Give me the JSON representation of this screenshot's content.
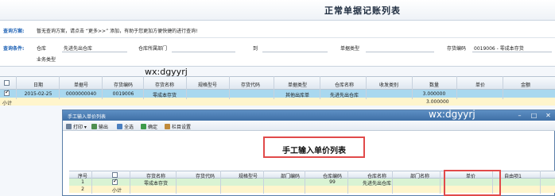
{
  "page": {
    "title": "正常单据记账列表"
  },
  "query_plan": {
    "label": "查询方案:",
    "hint": "暂无查询方案，请点击 “更多>>” 添加，有助于您更加方便快捷的进行查询!"
  },
  "conditions": {
    "label": "查询条件:",
    "warehouse_label": "仓库",
    "warehouse_value": "先进先出仓库",
    "warehouse_dept_label": "仓库所属部门",
    "to_label": "到",
    "doc_type_label": "单据类型",
    "inventory_code_label": "存货编码",
    "inventory_code_value": "0019006 - 零成本存货",
    "business_type_label": "业务类型"
  },
  "watermarks": [
    "wx:dgyyrj",
    "wx:dgyyrj"
  ],
  "main_grid": {
    "headers": [
      "选择",
      "日期",
      "单据号",
      "存货编码",
      "存货名称",
      "规格型号",
      "存货代码",
      "单据类型",
      "仓库名称",
      "收发类别",
      "数量",
      "单价",
      "金额"
    ],
    "rows": [
      {
        "checked": true,
        "cells": [
          "2015-02-25",
          "0000000040",
          "0019006",
          "零成本存货",
          "",
          "",
          "其他出库单",
          "先进先出仓库",
          "",
          "3.000000",
          "",
          ""
        ]
      }
    ],
    "subtotal_label": "小计",
    "subtotal_qty": "3.000000"
  },
  "popup": {
    "title": "手工输入单价列表",
    "toolbar": [
      "打印",
      "输出",
      "全选",
      "确定",
      "栏目设置"
    ],
    "heading": "手工输入单价列表",
    "headers": [
      "序号",
      "",
      "存货名称",
      "存货代码",
      "规格型号",
      "部门编码",
      "仓库编码",
      "仓库名称",
      "部门名称",
      "单价",
      "自由项1"
    ],
    "rows": [
      {
        "checked": true,
        "cells": [
          "1",
          "",
          "零成本存货",
          "",
          "",
          "",
          "99",
          "先进先出仓库",
          "",
          "",
          ""
        ]
      }
    ],
    "subtotal_row_no": "2",
    "subtotal_label": "小计"
  },
  "colors": {
    "selected_row": "#a9d8ef",
    "subtotal_row": "#fff5cc",
    "popup_row": "#d9f3d3",
    "title_bar": "#3f6fa5",
    "highlight_box": "#e14a4a"
  }
}
